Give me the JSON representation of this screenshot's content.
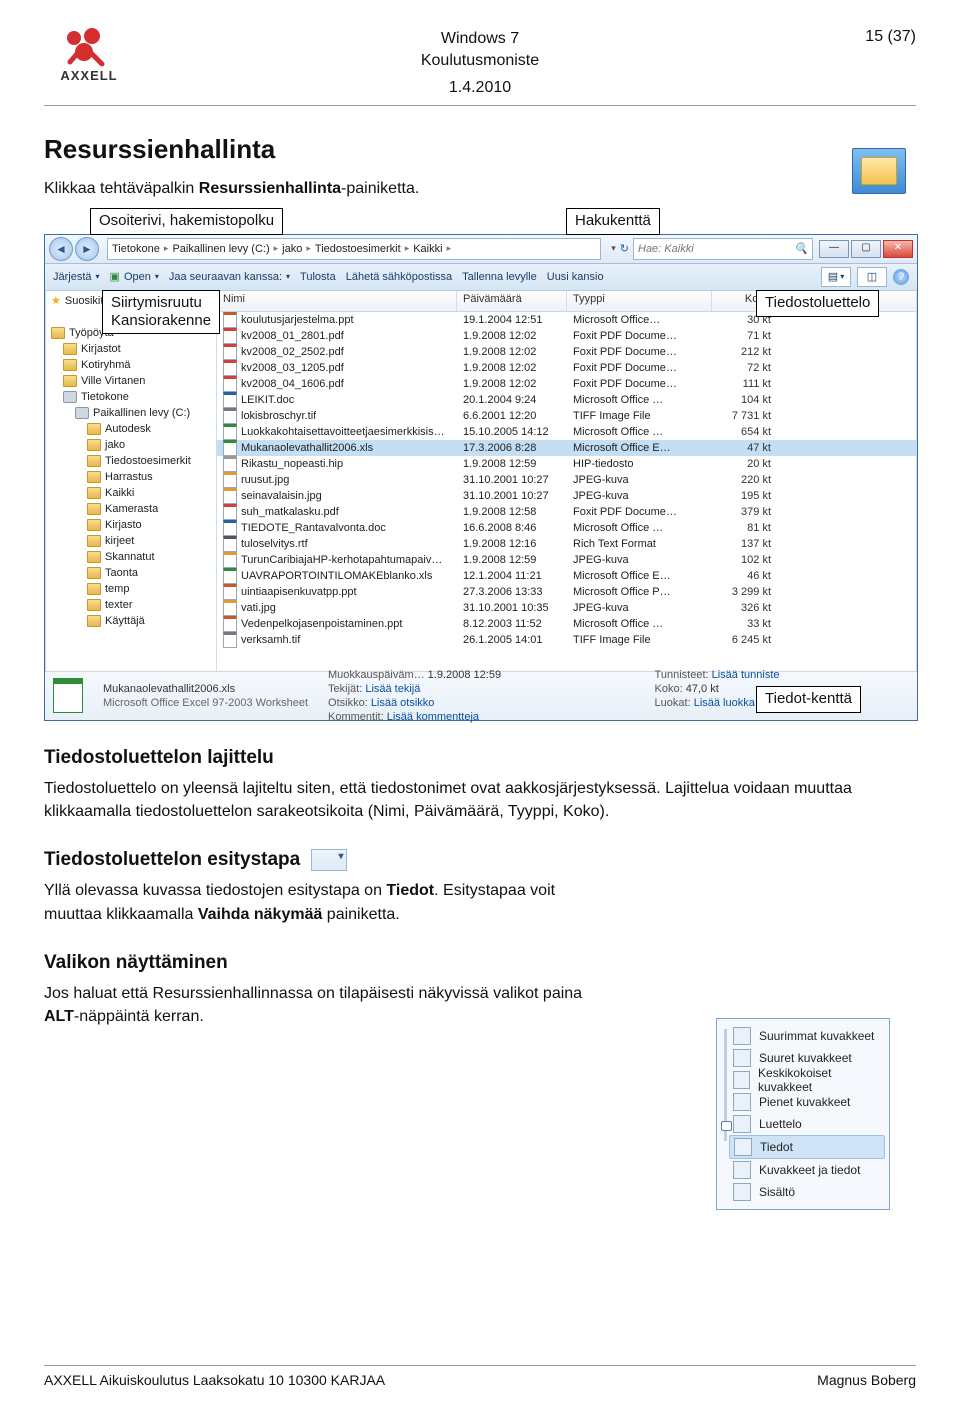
{
  "header": {
    "line1": "Windows 7",
    "line2": "Koulutusmoniste",
    "date": "1.4.2010",
    "page_indicator": "15 (37)",
    "logo_text": "AXXELL"
  },
  "taskbar_icon": {
    "label": "Resurssienhallinta-pikakuvake"
  },
  "h1": "Resurssienhallinta",
  "intro_plain": "Klikkaa tehtäväpalkin ",
  "intro_bold": "Resurssienhallinta",
  "intro_tail": "-painiketta.",
  "callouts": {
    "address": "Osoiterivi, hakemistopolku",
    "search": "Hakukenttä",
    "navpane_l1": "Siirtymisruutu",
    "navpane_l2": "Kansiorakenne",
    "filelist": "Tiedostoluettelo",
    "details": "Tiedot-kenttä"
  },
  "explorer": {
    "breadcrumbs": [
      "Tietokone",
      "Paikallinen levy (C:)",
      "jako",
      "Tiedostoesimerkit",
      "Kaikki"
    ],
    "search_hint": "Hae: Kaikki",
    "toolbar": {
      "jarj": "Järjestä",
      "open": "Open",
      "share": "Jaa seuraavan kanssa:",
      "print": "Tulosta",
      "email": "Lähetä sähköpostissa",
      "save": "Tallenna levylle",
      "new": "Uusi kansio"
    },
    "columns": {
      "name": "Nimi",
      "date": "Päivämäärä",
      "type": "Tyyppi",
      "size": "Koko",
      "tags": "Tunnisteet"
    },
    "tree": {
      "favorites": "Suosikit",
      "desktop": "Työpöytä",
      "libraries": "Kirjastot",
      "homegroup": "Kotiryhmä",
      "user": "Ville Virtanen",
      "computer": "Tietokone",
      "cdrive": "Paikallinen levy (C:)",
      "autodesk": "Autodesk",
      "jako": "jako",
      "tiedosto": "Tiedostoesimerkit",
      "harrastus": "Harrastus",
      "kaikki": "Kaikki",
      "kamerasta": "Kamerasta",
      "kirjasto": "Kirjasto",
      "kirjeet": "kirjeet",
      "skannatut": "Skannatut",
      "taonta": "Taonta",
      "temp": "temp",
      "texter": "texter",
      "kayttaja": "Käyttäjä"
    },
    "files": [
      {
        "icon": "ppt",
        "name": "koulutusjarjestelma.ppt",
        "date": "19.1.2004 12:51",
        "type": "Microsoft Office…",
        "size": "30 kt"
      },
      {
        "icon": "pdf",
        "name": "kv2008_01_2801.pdf",
        "date": "1.9.2008 12:02",
        "type": "Foxit PDF Docume…",
        "size": "71 kt"
      },
      {
        "icon": "pdf",
        "name": "kv2008_02_2502.pdf",
        "date": "1.9.2008 12:02",
        "type": "Foxit PDF Docume…",
        "size": "212 kt"
      },
      {
        "icon": "pdf",
        "name": "kv2008_03_1205.pdf",
        "date": "1.9.2008 12:02",
        "type": "Foxit PDF Docume…",
        "size": "72 kt"
      },
      {
        "icon": "pdf",
        "name": "kv2008_04_1606.pdf",
        "date": "1.9.2008 12:02",
        "type": "Foxit PDF Docume…",
        "size": "111 kt"
      },
      {
        "icon": "doc",
        "name": "LEIKIT.doc",
        "date": "20.1.2004 9:24",
        "type": "Microsoft Office …",
        "size": "104 kt"
      },
      {
        "icon": "tif",
        "name": "lokisbroschyr.tif",
        "date": "6.6.2001 12:20",
        "type": "TIFF Image File",
        "size": "7 731 kt"
      },
      {
        "icon": "xls",
        "name": "Luokkakohtaisettavoitteetjaesimerkkisis…",
        "date": "15.10.2005 14:12",
        "type": "Microsoft Office …",
        "size": "654 kt"
      },
      {
        "icon": "xls",
        "name": "Mukanaolevathallit2006.xls",
        "date": "17.3.2006 8:28",
        "type": "Microsoft Office E…",
        "size": "47 kt",
        "selected": true
      },
      {
        "icon": "hip",
        "name": "Rikastu_nopeasti.hip",
        "date": "1.9.2008 12:59",
        "type": "HIP-tiedosto",
        "size": "20 kt"
      },
      {
        "icon": "jpg",
        "name": "ruusut.jpg",
        "date": "31.10.2001 10:27",
        "type": "JPEG-kuva",
        "size": "220 kt"
      },
      {
        "icon": "jpg",
        "name": "seinavalaisin.jpg",
        "date": "31.10.2001 10:27",
        "type": "JPEG-kuva",
        "size": "195 kt"
      },
      {
        "icon": "pdf",
        "name": "suh_matkalasku.pdf",
        "date": "1.9.2008 12:58",
        "type": "Foxit PDF Docume…",
        "size": "379 kt"
      },
      {
        "icon": "doc",
        "name": "TIEDOTE_Rantavalvonta.doc",
        "date": "16.6.2008 8:46",
        "type": "Microsoft Office …",
        "size": "81 kt"
      },
      {
        "icon": "rtf",
        "name": "tuloselvitys.rtf",
        "date": "1.9.2008 12:16",
        "type": "Rich Text Format",
        "size": "137 kt"
      },
      {
        "icon": "jpg",
        "name": "TurunCaribiajaHP-kerhotapahtumapaiv…",
        "date": "1.9.2008 12:59",
        "type": "JPEG-kuva",
        "size": "102 kt"
      },
      {
        "icon": "xls",
        "name": "UAVRAPORTOINTILOMAKEblanko.xls",
        "date": "12.1.2004 11:21",
        "type": "Microsoft Office E…",
        "size": "46 kt"
      },
      {
        "icon": "ppt",
        "name": "uintiaapisenkuvatpp.ppt",
        "date": "27.3.2006 13:33",
        "type": "Microsoft Office P…",
        "size": "3 299 kt"
      },
      {
        "icon": "jpg",
        "name": "vati.jpg",
        "date": "31.10.2001 10:35",
        "type": "JPEG-kuva",
        "size": "326 kt"
      },
      {
        "icon": "ppt",
        "name": "Vedenpelkojasenpoistaminen.ppt",
        "date": "8.12.2003 11:52",
        "type": "Microsoft Office …",
        "size": "33 kt"
      },
      {
        "icon": "tif",
        "name": "verksamh.tif",
        "date": "26.1.2005 14:01",
        "type": "TIFF Image File",
        "size": "6 245 kt"
      }
    ],
    "details": {
      "filename": "Mukanaolevathallit2006.xls",
      "filedesc": "Microsoft Office Excel 97-2003 Worksheet",
      "muokkaus_k": "Muokkauspäiväm…",
      "muokkaus_v": "1.9.2008 12:59",
      "tekijat_k": "Tekijät:",
      "tekijat_v": "Lisää tekijä",
      "tunnisteet_k": "Tunnisteet:",
      "tunnisteet_v": "Lisää tunniste",
      "koko_k": "Koko:",
      "koko_v": "47,0 kt",
      "otsikko_k": "Otsikko:",
      "otsikko_v": "Lisää otsikko",
      "kommentit_k": "Kommentit:",
      "kommentit_v": "Lisää kommentteja",
      "luokat_k": "Luokat:",
      "luokat_v": "Lisää luokka"
    }
  },
  "section_sort": {
    "title": "Tiedostoluettelon lajittelu",
    "p": "Tiedostoluettelo on yleensä lajiteltu siten, että tiedostonimet ovat aakkosjärjestyksessä. Lajittelua voidaan muuttaa klikkaamalla tiedostoluettelon sarakeotsikoita (Nimi, Päivämäärä, Tyyppi, Koko)."
  },
  "section_view": {
    "title": "Tiedostoluettelon esitystapa",
    "p_pre": "Yllä olevassa kuvassa tiedostojen esitystapa on ",
    "p_bold1": "Tiedot",
    "p_mid": ". Esitystapaa voit muuttaa klikkaamalla ",
    "p_bold2": "Vaihda näkymää",
    "p_post": " painiketta."
  },
  "section_menu": {
    "title": "Valikon näyttäminen",
    "p_pre": "Jos haluat että Resurssienhallinnassa on tilapäisesti näkyvissä valikot paina ",
    "p_bold": "ALT",
    "p_post": "-näppäintä kerran."
  },
  "views_menu": {
    "items": [
      "Suurimmat kuvakkeet",
      "Suuret kuvakkeet",
      "Keskikokoiset kuvakkeet",
      "Pienet kuvakkeet",
      "Luettelo",
      "Tiedot",
      "Kuvakkeet ja tiedot",
      "Sisältö"
    ],
    "selected_index": 5
  },
  "footer": {
    "left": "AXXELL Aikuiskoulutus Laaksokatu 10 10300 KARJAA",
    "right": "Magnus Boberg"
  }
}
